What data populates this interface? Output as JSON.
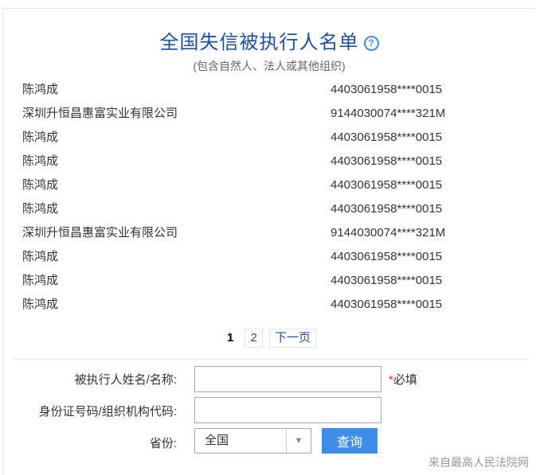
{
  "header": {
    "title": "全国失信被执行人名单",
    "help_icon": "question-circle-icon",
    "subtitle": "(包含自然人、法人或其他组织)"
  },
  "results": [
    {
      "name": "陈鸿成",
      "code": "4403061958****0015"
    },
    {
      "name": "深圳升恒昌惠富实业有限公司",
      "code": "9144030074****321M"
    },
    {
      "name": "陈鸿成",
      "code": "4403061958****0015"
    },
    {
      "name": "陈鸿成",
      "code": "4403061958****0015"
    },
    {
      "name": "陈鸿成",
      "code": "4403061958****0015"
    },
    {
      "name": "陈鸿成",
      "code": "4403061958****0015"
    },
    {
      "name": "深圳升恒昌惠富实业有限公司",
      "code": "9144030074****321M"
    },
    {
      "name": "陈鸿成",
      "code": "4403061958****0015"
    },
    {
      "name": "陈鸿成",
      "code": "4403061958****0015"
    },
    {
      "name": "陈鸿成",
      "code": "4403061958****0015"
    }
  ],
  "pagination": {
    "current": "1",
    "page2": "2",
    "next": "下一页"
  },
  "form": {
    "name_label": "被执行人姓名/名称:",
    "name_value": "",
    "required_mark": "*",
    "required_text": "必填",
    "id_label": "身份证号码/组织机构代码:",
    "id_value": "",
    "province_label": "省份:",
    "province_value": "全国",
    "query_button": "查询"
  },
  "footer": {
    "source": "来自最高人民法院网"
  },
  "colors": {
    "title": "#1e50a2",
    "button": "#3c8ee8",
    "required": "#e02020"
  }
}
